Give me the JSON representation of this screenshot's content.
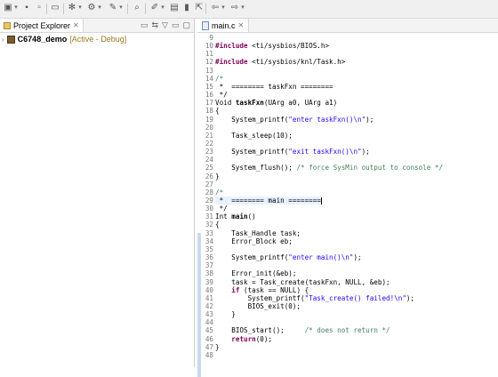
{
  "toolbar": {
    "icons": [
      "new-icon",
      "dropdown",
      "save-icon",
      "save-all-icon",
      "print-icon",
      "terminal-icon",
      "debug-icon",
      "dropdown",
      "flash-icon",
      "dropdown",
      "tools-icon",
      "dropdown",
      "search-icon",
      "pen-icon",
      "dropdown",
      "markers-icon",
      "bookmark-icon",
      "cursor-icon",
      "back-icon",
      "forward-icon",
      "dropdown"
    ]
  },
  "project_explorer": {
    "tab_label": "Project Explorer",
    "close_glyph": "✕",
    "project": {
      "expander": "›",
      "name": "C6748_demo",
      "status": "[Active - Debug]"
    }
  },
  "editor": {
    "tab_label": "main.c",
    "close_glyph": "✕",
    "lines": [
      {
        "n": "9",
        "code": ""
      },
      {
        "n": "10",
        "code": "#include <ti/sysbios/BIOS.h>"
      },
      {
        "n": "11",
        "code": ""
      },
      {
        "n": "12",
        "code": "#include <ti/sysbios/knl/Task.h>"
      },
      {
        "n": "13",
        "code": ""
      },
      {
        "n": "14",
        "code": "/*"
      },
      {
        "n": "15",
        "code": " *  ======== taskFxn ========"
      },
      {
        "n": "16",
        "code": " */"
      },
      {
        "n": "17",
        "code": "Void taskFxn(UArg a0, UArg a1)"
      },
      {
        "n": "18",
        "code": "{"
      },
      {
        "n": "19",
        "code": "    System_printf(\"enter taskFxn()\\n\");"
      },
      {
        "n": "20",
        "code": ""
      },
      {
        "n": "21",
        "code": "    Task_sleep(10);"
      },
      {
        "n": "22",
        "code": ""
      },
      {
        "n": "23",
        "code": "    System_printf(\"exit taskFxn()\\n\");"
      },
      {
        "n": "24",
        "code": ""
      },
      {
        "n": "25",
        "code": "    System_flush(); /* force SysMin output to console */"
      },
      {
        "n": "26",
        "code": "}"
      },
      {
        "n": "27",
        "code": ""
      },
      {
        "n": "28",
        "code": "/*"
      },
      {
        "n": "29",
        "code": " *  ======== main ========"
      },
      {
        "n": "30",
        "code": " */"
      },
      {
        "n": "31",
        "code": "Int main()"
      },
      {
        "n": "32",
        "code": "{"
      },
      {
        "n": "33",
        "code": "    Task_Handle task;"
      },
      {
        "n": "34",
        "code": "    Error_Block eb;"
      },
      {
        "n": "35",
        "code": ""
      },
      {
        "n": "36",
        "code": "    System_printf(\"enter main()\\n\");"
      },
      {
        "n": "37",
        "code": ""
      },
      {
        "n": "38",
        "code": "    Error_init(&eb);"
      },
      {
        "n": "39",
        "code": "    task = Task_create(taskFxn, NULL, &eb);"
      },
      {
        "n": "40",
        "code": "    if (task == NULL) {"
      },
      {
        "n": "41",
        "code": "        System_printf(\"Task_create() failed!\\n\");"
      },
      {
        "n": "42",
        "code": "        BIOS_exit(0);"
      },
      {
        "n": "43",
        "code": "    }"
      },
      {
        "n": "44",
        "code": ""
      },
      {
        "n": "45",
        "code": "    BIOS_start();     /* does not return */"
      },
      {
        "n": "46",
        "code": "    return(0);"
      },
      {
        "n": "47",
        "code": "}"
      },
      {
        "n": "48",
        "code": ""
      }
    ]
  }
}
